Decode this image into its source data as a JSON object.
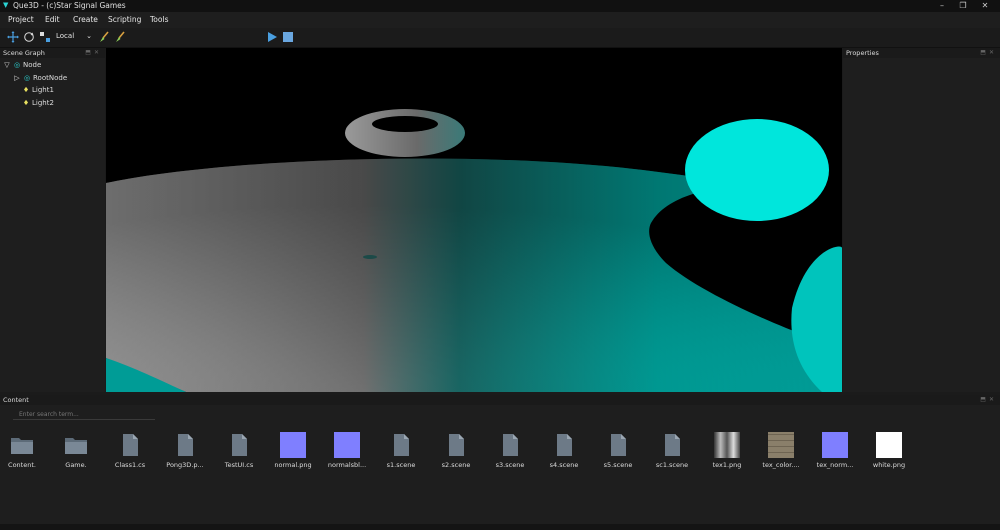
{
  "window": {
    "title": "Que3D - (c)Star Signal Games",
    "controls": [
      "minimize-icon",
      "restore-icon",
      "close-icon"
    ]
  },
  "menu": {
    "items": [
      "Project",
      "Edit",
      "Create",
      "Scripting",
      "Tools"
    ]
  },
  "toolbar": {
    "tools": [
      "move-icon",
      "rotate-icon",
      "scale-icon"
    ],
    "space": "Local",
    "extra": [
      "paint-brush-icon",
      "paint-brush-icon"
    ],
    "play": [
      "play-icon",
      "stop-icon"
    ],
    "accent": "#4a9fe0"
  },
  "scene_graph": {
    "title": "Scene Graph",
    "nodes": [
      {
        "label": "Node",
        "level": 0
      },
      {
        "label": "RootNode",
        "level": 1
      },
      {
        "label": "Light1",
        "level": 2
      },
      {
        "label": "Light2",
        "level": 2
      }
    ]
  },
  "properties": {
    "title": "Properties"
  },
  "viewport": {
    "colors": {
      "cyan": "#00d8d0",
      "floor_gray": "#8c8c8c",
      "background": "#000000"
    }
  },
  "content": {
    "title": "Content",
    "search_placeholder": "Enter search term...",
    "assets": [
      {
        "label": "Content.",
        "kind": "folder"
      },
      {
        "label": "Game.",
        "kind": "folder"
      },
      {
        "label": "Class1.cs",
        "kind": "file"
      },
      {
        "label": "Pong3D.p...",
        "kind": "file"
      },
      {
        "label": "TestUI.cs",
        "kind": "file"
      },
      {
        "label": "normal.png",
        "kind": "normal"
      },
      {
        "label": "normalsbl...",
        "kind": "normal"
      },
      {
        "label": "s1.scene",
        "kind": "file"
      },
      {
        "label": "s2.scene",
        "kind": "file"
      },
      {
        "label": "s3.scene",
        "kind": "file"
      },
      {
        "label": "s4.scene",
        "kind": "file"
      },
      {
        "label": "s5.scene",
        "kind": "file"
      },
      {
        "label": "sc1.scene",
        "kind": "file"
      },
      {
        "label": "tex1.png",
        "kind": "tex-metal"
      },
      {
        "label": "tex_color....",
        "kind": "tex-stone"
      },
      {
        "label": "tex_norm...",
        "kind": "tex-normal"
      },
      {
        "label": "white.png",
        "kind": "white"
      }
    ]
  }
}
